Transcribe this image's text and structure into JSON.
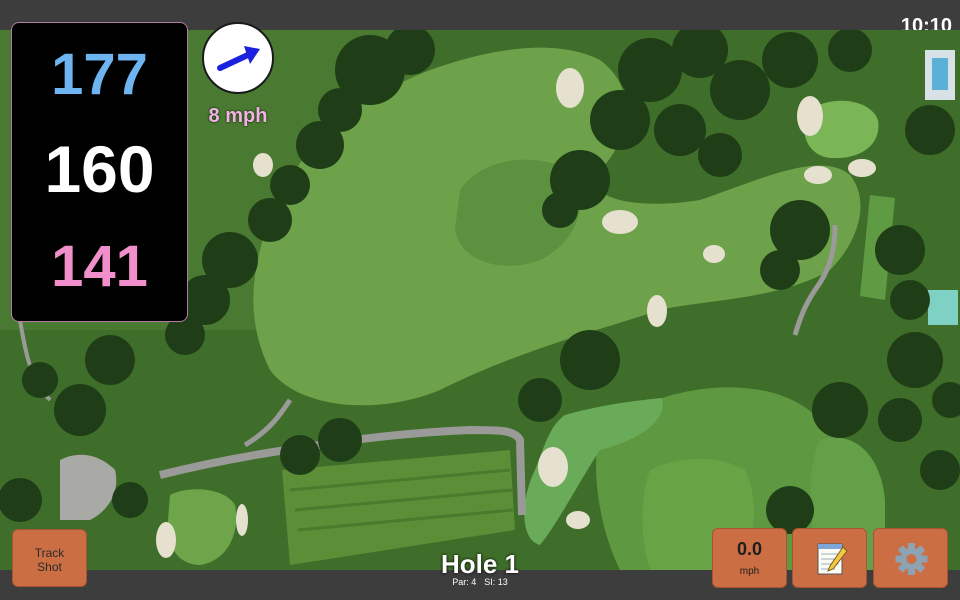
{
  "status_bar": {
    "time": "10:10"
  },
  "yardages": {
    "back": "177",
    "middle": "160",
    "front": "141"
  },
  "wind": {
    "speed": "8 mph",
    "icon": "wind-arrow-icon"
  },
  "buttons": {
    "track_shot_line1": "Track",
    "track_shot_line2": "Shot",
    "speed_value": "0.0",
    "speed_unit": "mph",
    "notes_icon": "notepad-icon",
    "settings_icon": "gear-icon"
  },
  "hole": {
    "title": "Hole 1",
    "par": "Par: 4",
    "stroke_index": "SI: 13"
  },
  "colors": {
    "back_yardage": "#6db4f0",
    "middle_yardage": "#ffffff",
    "front_yardage": "#f08fc9",
    "button_orange": "#cc6e43",
    "wind_arrow": "#1a22e0",
    "wind_label": "#f0b4e4"
  }
}
